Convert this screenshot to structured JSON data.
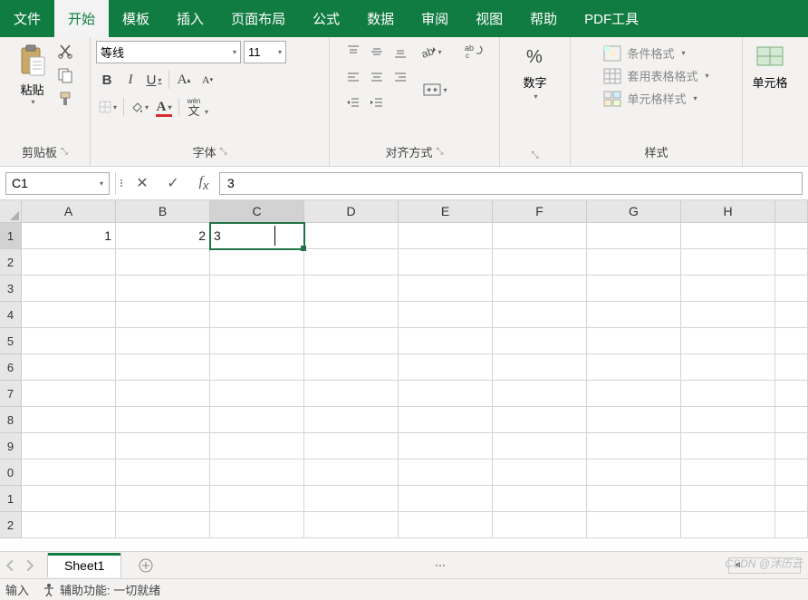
{
  "tabs": [
    "文件",
    "开始",
    "模板",
    "插入",
    "页面布局",
    "公式",
    "数据",
    "审阅",
    "视图",
    "帮助",
    "PDF工具"
  ],
  "active_tab_index": 1,
  "ribbon": {
    "clipboard": {
      "paste": "粘贴",
      "label": "剪贴板"
    },
    "font": {
      "name": "等线",
      "size": "11",
      "label": "字体",
      "wen": "wén",
      "wen2": "文"
    },
    "align": {
      "label": "对齐方式"
    },
    "number": {
      "label": "数字"
    },
    "styles": {
      "label": "样式",
      "cond": "条件格式",
      "table": "套用表格格式",
      "cell": "单元格样式"
    },
    "cells": {
      "label": "单元格"
    }
  },
  "namebox": "C1",
  "formula": "3",
  "columns": [
    "A",
    "B",
    "C",
    "D",
    "E",
    "F",
    "G",
    "H"
  ],
  "rows": [
    "1",
    "2",
    "3",
    "4",
    "5",
    "6",
    "7",
    "8",
    "9",
    "0",
    "1",
    "2"
  ],
  "celldata": {
    "A1": "1",
    "B1": "2",
    "C1": "3"
  },
  "active_cell": "C1",
  "sheet_tab": "Sheet1",
  "status": {
    "mode": "输入",
    "acc": "辅助功能: 一切就绪"
  },
  "watermark": "CSDN @沐历云"
}
